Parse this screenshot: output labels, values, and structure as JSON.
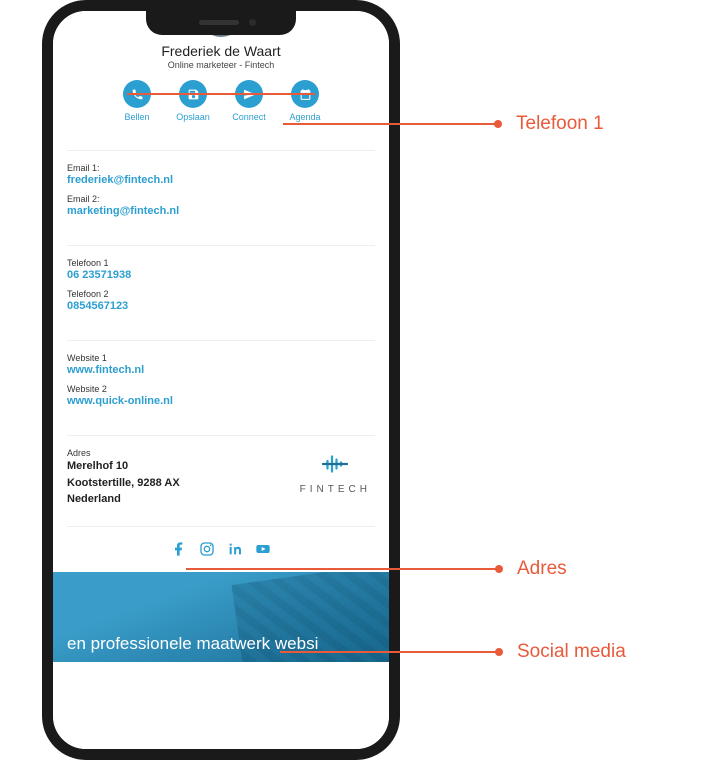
{
  "profile": {
    "name": "Frederiek de Waart",
    "role": "Online marketeer - Fintech"
  },
  "actions": {
    "call": {
      "label": "Bellen",
      "icon": "phone-icon"
    },
    "save": {
      "label": "Opslaan",
      "icon": "save-icon"
    },
    "connect": {
      "label": "Connect",
      "icon": "share-icon"
    },
    "agenda": {
      "label": "Agenda",
      "icon": "calendar-icon"
    }
  },
  "emails": {
    "label1": "Email 1:",
    "value1": "frederiek@fintech.nl",
    "label2": "Email 2:",
    "value2": "marketing@fintech.nl"
  },
  "phones": {
    "label1": "Telefoon 1",
    "value1": "06 23571938",
    "label2": "Telefoon 2",
    "value2": "0854567123"
  },
  "websites": {
    "label1": "Website 1",
    "value1": "www.fintech.nl",
    "label2": "Website 2",
    "value2": "www.quick-online.nl"
  },
  "address": {
    "label": "Adres",
    "line1": "Merelhof 10",
    "line2": "Kootstertille, 9288 AX",
    "line3": "Nederland"
  },
  "company_logo_text": "FINTECH",
  "social": {
    "facebook": "facebook-icon",
    "instagram": "instagram-icon",
    "linkedin": "linkedin-icon",
    "youtube": "youtube-icon"
  },
  "banner_text": "en professionele maatwerk websi",
  "annotations": {
    "telefoon1": "Telefoon 1",
    "adres": "Adres",
    "social": "Social media"
  },
  "colors": {
    "accent": "#2c9fd1",
    "annotation": "#e85a3a"
  }
}
